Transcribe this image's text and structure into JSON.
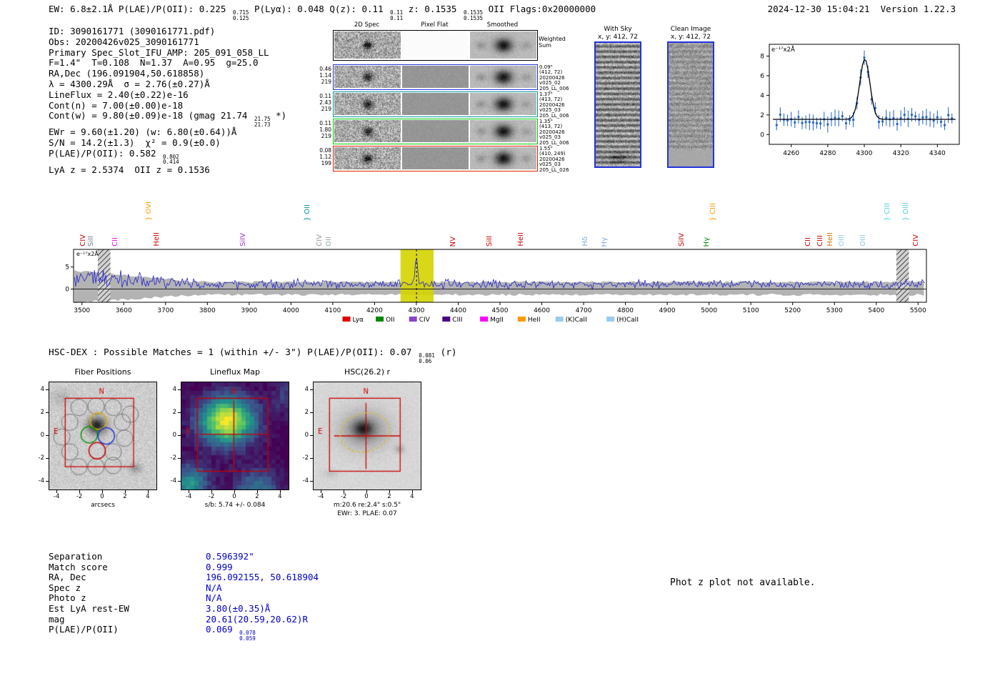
{
  "header": {
    "left_segments": [
      {
        "t": "EW: 6.8±2.1Å  P(LAE)/P(OII): 0.225 "
      },
      {
        "frac": [
          "0.715",
          "0.125"
        ]
      },
      {
        "t": "  P(Lyα): 0.048  Q(z): 0.11 "
      },
      {
        "frac": [
          "0.11",
          "0.11"
        ]
      },
      {
        "t": "  z: 0.1535 "
      },
      {
        "frac": [
          "0.1535",
          "0.1535"
        ]
      },
      {
        "t": " OII   Flags:0x20000000"
      }
    ],
    "timestamp": "2024-12-30 15:04:21",
    "version": "Version 1.22.3"
  },
  "info": {
    "lines": [
      "ID: 3090161771 (3090161771.pdf)",
      "Obs: 20200426v025_3090161771",
      "Primary Spec_Slot_IFU_AMP: 205_091_058_LL",
      "F=1.4\"  T=0.108  N̄=1.37  A=0.95  g=25.0",
      "RA,Dec (196.091904,50.618858)",
      "λ = 4300.29Å  σ = 2.76(±0.27)Å",
      "LineFlux = 2.40(±0.22)e-16",
      "Cont(n) = 7.00(±0.00)e-18",
      [
        {
          "t": "Cont(w) = 9.80(±0.09)e-18 (gmag 21.74 "
        },
        {
          "frac": [
            "21.75",
            "21.73"
          ]
        },
        {
          "t": " *)"
        }
      ],
      "EWr = 9.60(±1.20) (w: 6.80(±0.64))Å",
      "S/N = 14.2(±1.3)  χ² = 0.9(±0.0)",
      [
        {
          "t": "P(LAE)/P(OII): 0.582 "
        },
        {
          "frac": [
            "0.802",
            "0.414"
          ]
        }
      ],
      "LyA z = 2.5374  OII z = 0.1536"
    ]
  },
  "spec2d": {
    "columns": [
      "2D Spec",
      "Pixel Flat",
      "Smoothed"
    ],
    "weighted_sum_label": "Weighted Sum",
    "rows": [
      {
        "color": "#000000",
        "left": [],
        "right": []
      },
      {
        "color": "#2233dd",
        "left": [
          "0.46",
          "1.14",
          "219"
        ],
        "right": [
          "0.09\"",
          "(412, 72)",
          "20200426",
          "v025_02",
          "205_LL_006"
        ]
      },
      {
        "color": "#009999",
        "left": [
          "0.11",
          "2.43",
          "219"
        ],
        "right": [
          "1.37\"",
          "(413, 72)",
          "20200426",
          "v025_03",
          "205_LL_006"
        ]
      },
      {
        "color": "#00cc00",
        "left": [
          "0.11",
          "1.80",
          "219"
        ],
        "right": [
          "1.35\"",
          "(413, 72)",
          "20200426",
          "v025_03",
          "205_LL_006"
        ]
      },
      {
        "color": "#dd2200",
        "left": [
          "0.08",
          "1.12",
          "199"
        ],
        "right": [
          "1.55\"",
          "(410, 249)",
          "20200426",
          "v025_03",
          "205_LL_026"
        ]
      }
    ]
  },
  "sky_panels": [
    {
      "title": "With Sky",
      "coords": "x, y: 412, 72"
    },
    {
      "title": "Clean Image",
      "coords": "x, y: 412, 72"
    }
  ],
  "chart_data": [
    {
      "type": "scatter",
      "title": "emission line gaussian fit",
      "ylabel": "e⁻¹⁷x2Å",
      "xticks": [
        4260,
        4280,
        4300,
        4320,
        4340
      ],
      "yticks": [
        0,
        2,
        4,
        6,
        8
      ],
      "xlim": [
        4248,
        4352
      ],
      "ylim": [
        -1,
        9.2
      ],
      "center": 4300.29,
      "sigma": 2.76,
      "amplitude": 6.15,
      "continuum": 1.55,
      "point_color": "#2060d0",
      "fit_color": "#000000"
    },
    {
      "type": "line",
      "title": "full 1D spectrum",
      "ylabel": "e⁻¹⁷x2Å",
      "xticks": [
        3500,
        3600,
        3700,
        3800,
        3900,
        4000,
        4100,
        4200,
        4300,
        4400,
        4500,
        4600,
        4700,
        4800,
        4900,
        5000,
        5100,
        5200,
        5300,
        5400,
        5500
      ],
      "yticks": [
        0,
        5
      ],
      "xlim": [
        3480,
        5520
      ],
      "ylim": [
        -3,
        9
      ],
      "line_color": "#2222cc",
      "emission": {
        "center": 4300.29,
        "sigma": 3.0,
        "amplitude": 6.2
      },
      "highlight": {
        "x0": 4262,
        "x1": 4341,
        "color": "#d4d400"
      },
      "masked_bands": [
        [
          3538,
          3568
        ],
        [
          5448,
          5478
        ]
      ],
      "labels": [
        {
          "name": "CIV",
          "wave": 3505,
          "color": "#cc0000",
          "tier": 0
        },
        {
          "name": "SiII",
          "wave": 3524,
          "color": "#7a7a9a",
          "tier": 0
        },
        {
          "name": "CII",
          "wave": 3582,
          "color": "#ee00ee",
          "tier": 0
        },
        {
          "name": "OVI",
          "wave": 3663,
          "color": "#ff9900",
          "tier": 1,
          "brace": true
        },
        {
          "name": "HeII",
          "wave": 3682,
          "color": "#cc0000",
          "tier": 0
        },
        {
          "name": "SiIV",
          "wave": 3888,
          "color": "#9933cc",
          "tier": 0
        },
        {
          "name": "OII",
          "wave": 4042,
          "color": "#009999",
          "tier": 1,
          "brace": true
        },
        {
          "name": "CIV",
          "wave": 4072,
          "color": "#999999",
          "tier": 0
        },
        {
          "name": "OII",
          "wave": 4094,
          "color": "#99aaaa",
          "tier": 0
        },
        {
          "name": "NV",
          "wave": 4390,
          "color": "#cc0000",
          "tier": 0
        },
        {
          "name": "SiII",
          "wave": 4477,
          "color": "#cc0000",
          "tier": 0
        },
        {
          "name": "HeII",
          "wave": 4553,
          "color": "#cc0000",
          "tier": 0
        },
        {
          "name": "Hδ",
          "wave": 4706,
          "color": "#77aadd",
          "tier": 0
        },
        {
          "name": "Hγ",
          "wave": 4753,
          "color": "#77aadd",
          "tier": 0
        },
        {
          "name": "SiIV",
          "wave": 4938,
          "color": "#cc0000",
          "tier": 0
        },
        {
          "name": "Hγ",
          "wave": 4998,
          "color": "#008800",
          "tier": 0
        },
        {
          "name": "CIII",
          "wave": 5012,
          "color": "#ff9900",
          "tier": 1,
          "brace": true
        },
        {
          "name": "CII",
          "wave": 5240,
          "color": "#cc0000",
          "tier": 0
        },
        {
          "name": "CIII",
          "wave": 5268,
          "color": "#cc0000",
          "tier": 0
        },
        {
          "name": "HeII",
          "wave": 5292,
          "color": "#cc7700",
          "tier": 0
        },
        {
          "name": "OIII",
          "wave": 5320,
          "color": "#88ccee",
          "tier": 0
        },
        {
          "name": "OIII",
          "wave": 5372,
          "color": "#88ccee",
          "tier": 0
        },
        {
          "name": "CIII",
          "wave": 5430,
          "color": "#55ccdd",
          "tier": 1,
          "brace": true
        },
        {
          "name": "OIII",
          "wave": 5474,
          "color": "#55ccdd",
          "tier": 1,
          "brace": true
        },
        {
          "name": "CIV",
          "wave": 5498,
          "color": "#cc0000",
          "tier": 0
        }
      ],
      "legend": [
        {
          "label": "Lyα",
          "color": "#dd0000"
        },
        {
          "label": "OII",
          "color": "#008800"
        },
        {
          "label": "CIV",
          "color": "#8844cc"
        },
        {
          "label": "CIII",
          "color": "#4b0082"
        },
        {
          "label": "MgII",
          "color": "#ff00ff"
        },
        {
          "label": "HeII",
          "color": "#ff9900"
        },
        {
          "label": "(K)CaII",
          "color": "#99ccee"
        },
        {
          "label": "(H)CaII",
          "color": "#99ccee"
        }
      ]
    }
  ],
  "hsc_line_segments": [
    {
      "t": "HSC-DEX : Possible Matches = 1 (within +/- 3\")  P(LAE)/P(OII): 0.07 "
    },
    {
      "frac": [
        "0.081",
        "0.06"
      ]
    },
    {
      "t": " (r)"
    }
  ],
  "cutouts": [
    {
      "title": "Fiber Positions",
      "captions": [
        "arcsecs"
      ],
      "ticks": [
        -4,
        -2,
        0,
        2,
        4
      ],
      "compass": [
        "N",
        "E"
      ]
    },
    {
      "title": "Lineflux Map",
      "captions": [
        "s/b: 5.74 +/- 0.084"
      ],
      "ticks": [
        -4,
        -2,
        0,
        2,
        4
      ],
      "compass": [
        "N",
        "E"
      ]
    },
    {
      "title": "HSC(26.2) r",
      "captions": [
        "m:20.6 re:2.4\" s:0.5\"",
        "EWr: 3. PLAE: 0.07"
      ],
      "ticks": [
        -4,
        -2,
        0,
        2,
        4
      ],
      "compass": [
        "N",
        "E"
      ]
    }
  ],
  "match_table": {
    "value_color": "#0000cc",
    "rows": [
      {
        "label": "Separation",
        "value": [
          {
            "t": "0.596392\""
          }
        ]
      },
      {
        "label": "Match score",
        "value": [
          {
            "t": "0.999"
          }
        ]
      },
      {
        "label": "RA, Dec",
        "value": [
          {
            "t": "196.092155, 50.618904"
          }
        ]
      },
      {
        "label": "Spec z",
        "value": [
          {
            "t": "N/A"
          }
        ]
      },
      {
        "label": "Photo z",
        "value": [
          {
            "t": "N/A"
          }
        ]
      },
      {
        "label": "Est LyA rest-EW",
        "value": [
          {
            "t": "3.80(±0.35)Å"
          }
        ]
      },
      {
        "label": "mag",
        "value": [
          {
            "t": "20.61(20.59,20.62)R"
          }
        ]
      },
      {
        "label": "P(LAE)/P(OII)",
        "value": [
          {
            "t": "0.069 "
          },
          {
            "frac": [
              "0.078",
              "0.059"
            ]
          }
        ]
      }
    ]
  },
  "phot_z_note": "Phot z plot not available."
}
